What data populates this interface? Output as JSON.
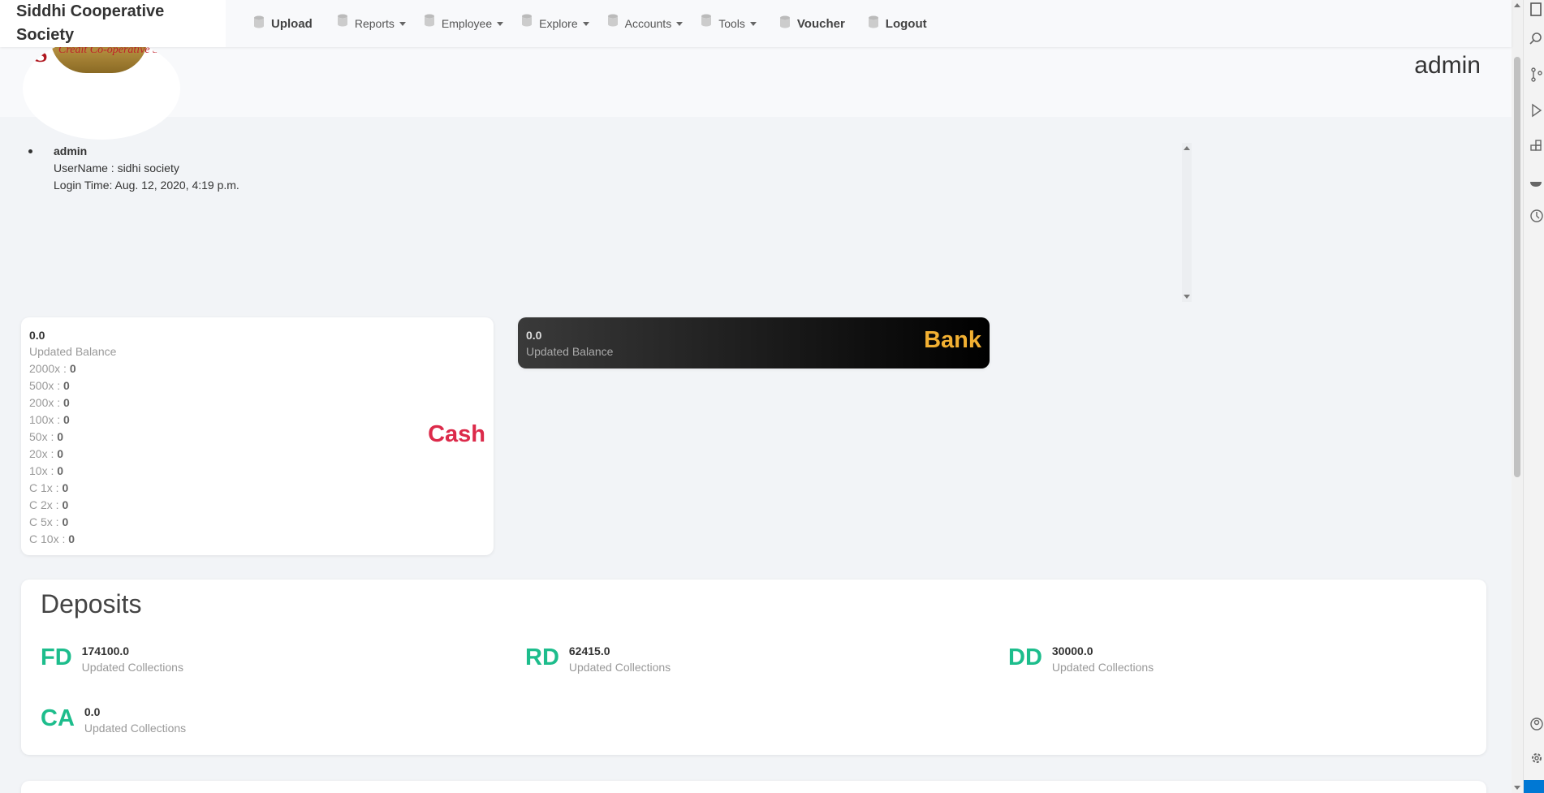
{
  "brand": {
    "line1": "Siddhi Cooperative",
    "line2": "Society"
  },
  "nav": {
    "items": [
      {
        "label": "Upload",
        "bold": true,
        "dropdown": false
      },
      {
        "label": "Reports",
        "bold": false,
        "dropdown": true
      },
      {
        "label": "Employee",
        "bold": false,
        "dropdown": true
      },
      {
        "label": "Explore",
        "bold": false,
        "dropdown": true
      },
      {
        "label": "Accounts",
        "bold": false,
        "dropdown": true
      },
      {
        "label": "Tools",
        "bold": false,
        "dropdown": true
      },
      {
        "label": "Voucher",
        "bold": true,
        "dropdown": false
      },
      {
        "label": "Logout",
        "bold": true,
        "dropdown": false
      }
    ]
  },
  "banner": {
    "logo_text": "Credit Co-operative Society Ltd.",
    "user": "admin"
  },
  "user_info": {
    "name": "admin",
    "username": "UserName : sidhi society",
    "login_time": "Login Time: Aug. 12, 2020, 4:19 p.m."
  },
  "cash": {
    "value": "0.0",
    "subtitle": "Updated Balance",
    "label": "Cash",
    "denominations": [
      {
        "name": "2000x :",
        "count": "0"
      },
      {
        "name": "500x :",
        "count": "0"
      },
      {
        "name": "200x :",
        "count": "0"
      },
      {
        "name": "100x :",
        "count": "0"
      },
      {
        "name": "50x :",
        "count": "0"
      },
      {
        "name": "20x :",
        "count": "0"
      },
      {
        "name": "10x :",
        "count": "0"
      },
      {
        "name": "C 1x :",
        "count": "0"
      },
      {
        "name": "C 2x :",
        "count": "0"
      },
      {
        "name": "C 5x :",
        "count": "0"
      },
      {
        "name": "C 10x :",
        "count": "0"
      }
    ]
  },
  "bank": {
    "value": "0.0",
    "subtitle": "Updated Balance",
    "label": "Bank"
  },
  "deposits": {
    "title": "Deposits",
    "items": [
      {
        "code": "FD",
        "value": "174100.0",
        "subtitle": "Updated Collections"
      },
      {
        "code": "RD",
        "value": "62415.0",
        "subtitle": "Updated Collections"
      },
      {
        "code": "DD",
        "value": "30000.0",
        "subtitle": "Updated Collections"
      },
      {
        "code": "CA",
        "value": "0.0",
        "subtitle": "Updated Collections"
      }
    ]
  },
  "colors": {
    "cash": "#dc2a4a",
    "bank": "#f2b032",
    "deposit": "#1dbd8c"
  }
}
